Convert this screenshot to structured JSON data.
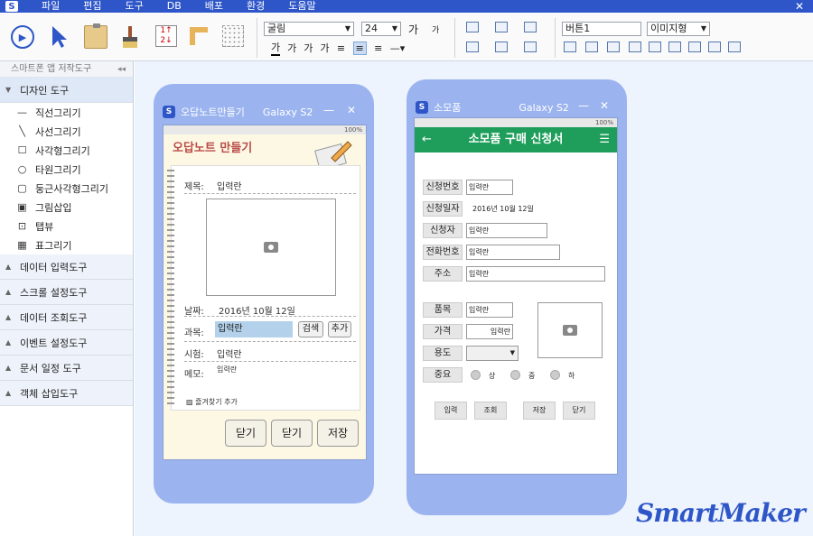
{
  "menu": {
    "items": [
      "파일",
      "편집",
      "도구",
      "DB",
      "배포",
      "환경",
      "도움말"
    ],
    "close": "✕"
  },
  "toolbar": {
    "font_family": "굴림",
    "font_size": "24",
    "grow_text": "가",
    "shrink_text": "가",
    "text_color_label": "가",
    "fmt_bold": "가",
    "fmt_italic": "가",
    "fmt_underline": "가",
    "control_name": "버튼1",
    "control_type": "이미지형"
  },
  "sidebar": {
    "title": "스마트폰 앱 저작도구",
    "collapse": "◂◂",
    "design_group": "디자인 도구",
    "design_items": [
      {
        "label": "직선그리기",
        "icon": "line-icon"
      },
      {
        "label": "사선그리기",
        "icon": "diagonal-icon"
      },
      {
        "label": "사각형그리기",
        "icon": "rectangle-icon"
      },
      {
        "label": "타원그리기",
        "icon": "ellipse-icon"
      },
      {
        "label": "둥근사각형그리기",
        "icon": "rounded-rect-icon"
      },
      {
        "label": "그림삽입",
        "icon": "image-icon"
      },
      {
        "label": "탭뷰",
        "icon": "tabview-icon"
      },
      {
        "label": "표그리기",
        "icon": "table-icon"
      }
    ],
    "groups": [
      "데이터 입력도구",
      "스크롤 설정도구",
      "데이터 조회도구",
      "이벤트 설정도구",
      "문서 일정 도구",
      "객체 삽입도구"
    ]
  },
  "phone1": {
    "window_title": "오답노트만들기",
    "device": "Galaxy S2",
    "status": "100%",
    "header": "오답노트 만들기",
    "subject_label": "제목:",
    "subject_value": "입력란",
    "date_label": "날짜:",
    "date_value": "2016년 10월 12일",
    "course_label": "과목:",
    "course_value": "입력란",
    "search_btn": "검색",
    "add_btn": "추가",
    "exam_label": "시험:",
    "exam_value": "입력란",
    "memo_label": "메모:",
    "memo_value": "입력란",
    "favorite": "즐겨찾기 추가",
    "btn1": "닫기",
    "btn2": "닫기",
    "btn3": "저장"
  },
  "phone2": {
    "window_title": "소모품",
    "device": "Galaxy S2",
    "status": "100%",
    "header": "소모품 구매 신청서",
    "back": "←",
    "menu": "☰",
    "fields": [
      {
        "label": "신청번호",
        "value": "입력란"
      },
      {
        "label": "신청일자",
        "value": "2016년 10월 12일"
      },
      {
        "label": "신청자",
        "value": "입력란"
      },
      {
        "label": "전화번호",
        "value": "입력란"
      },
      {
        "label": "주소",
        "value": "입력란"
      },
      {
        "label": "품목",
        "value": "입력란"
      },
      {
        "label": "가격",
        "value": "입력란"
      },
      {
        "label": "용도",
        "value": ""
      },
      {
        "label": "중요",
        "value": ""
      }
    ],
    "priority": [
      "상",
      "중",
      "하"
    ],
    "buttons": [
      "입력",
      "조회",
      "저장",
      "닫기"
    ]
  },
  "brand": "SmartMaker"
}
